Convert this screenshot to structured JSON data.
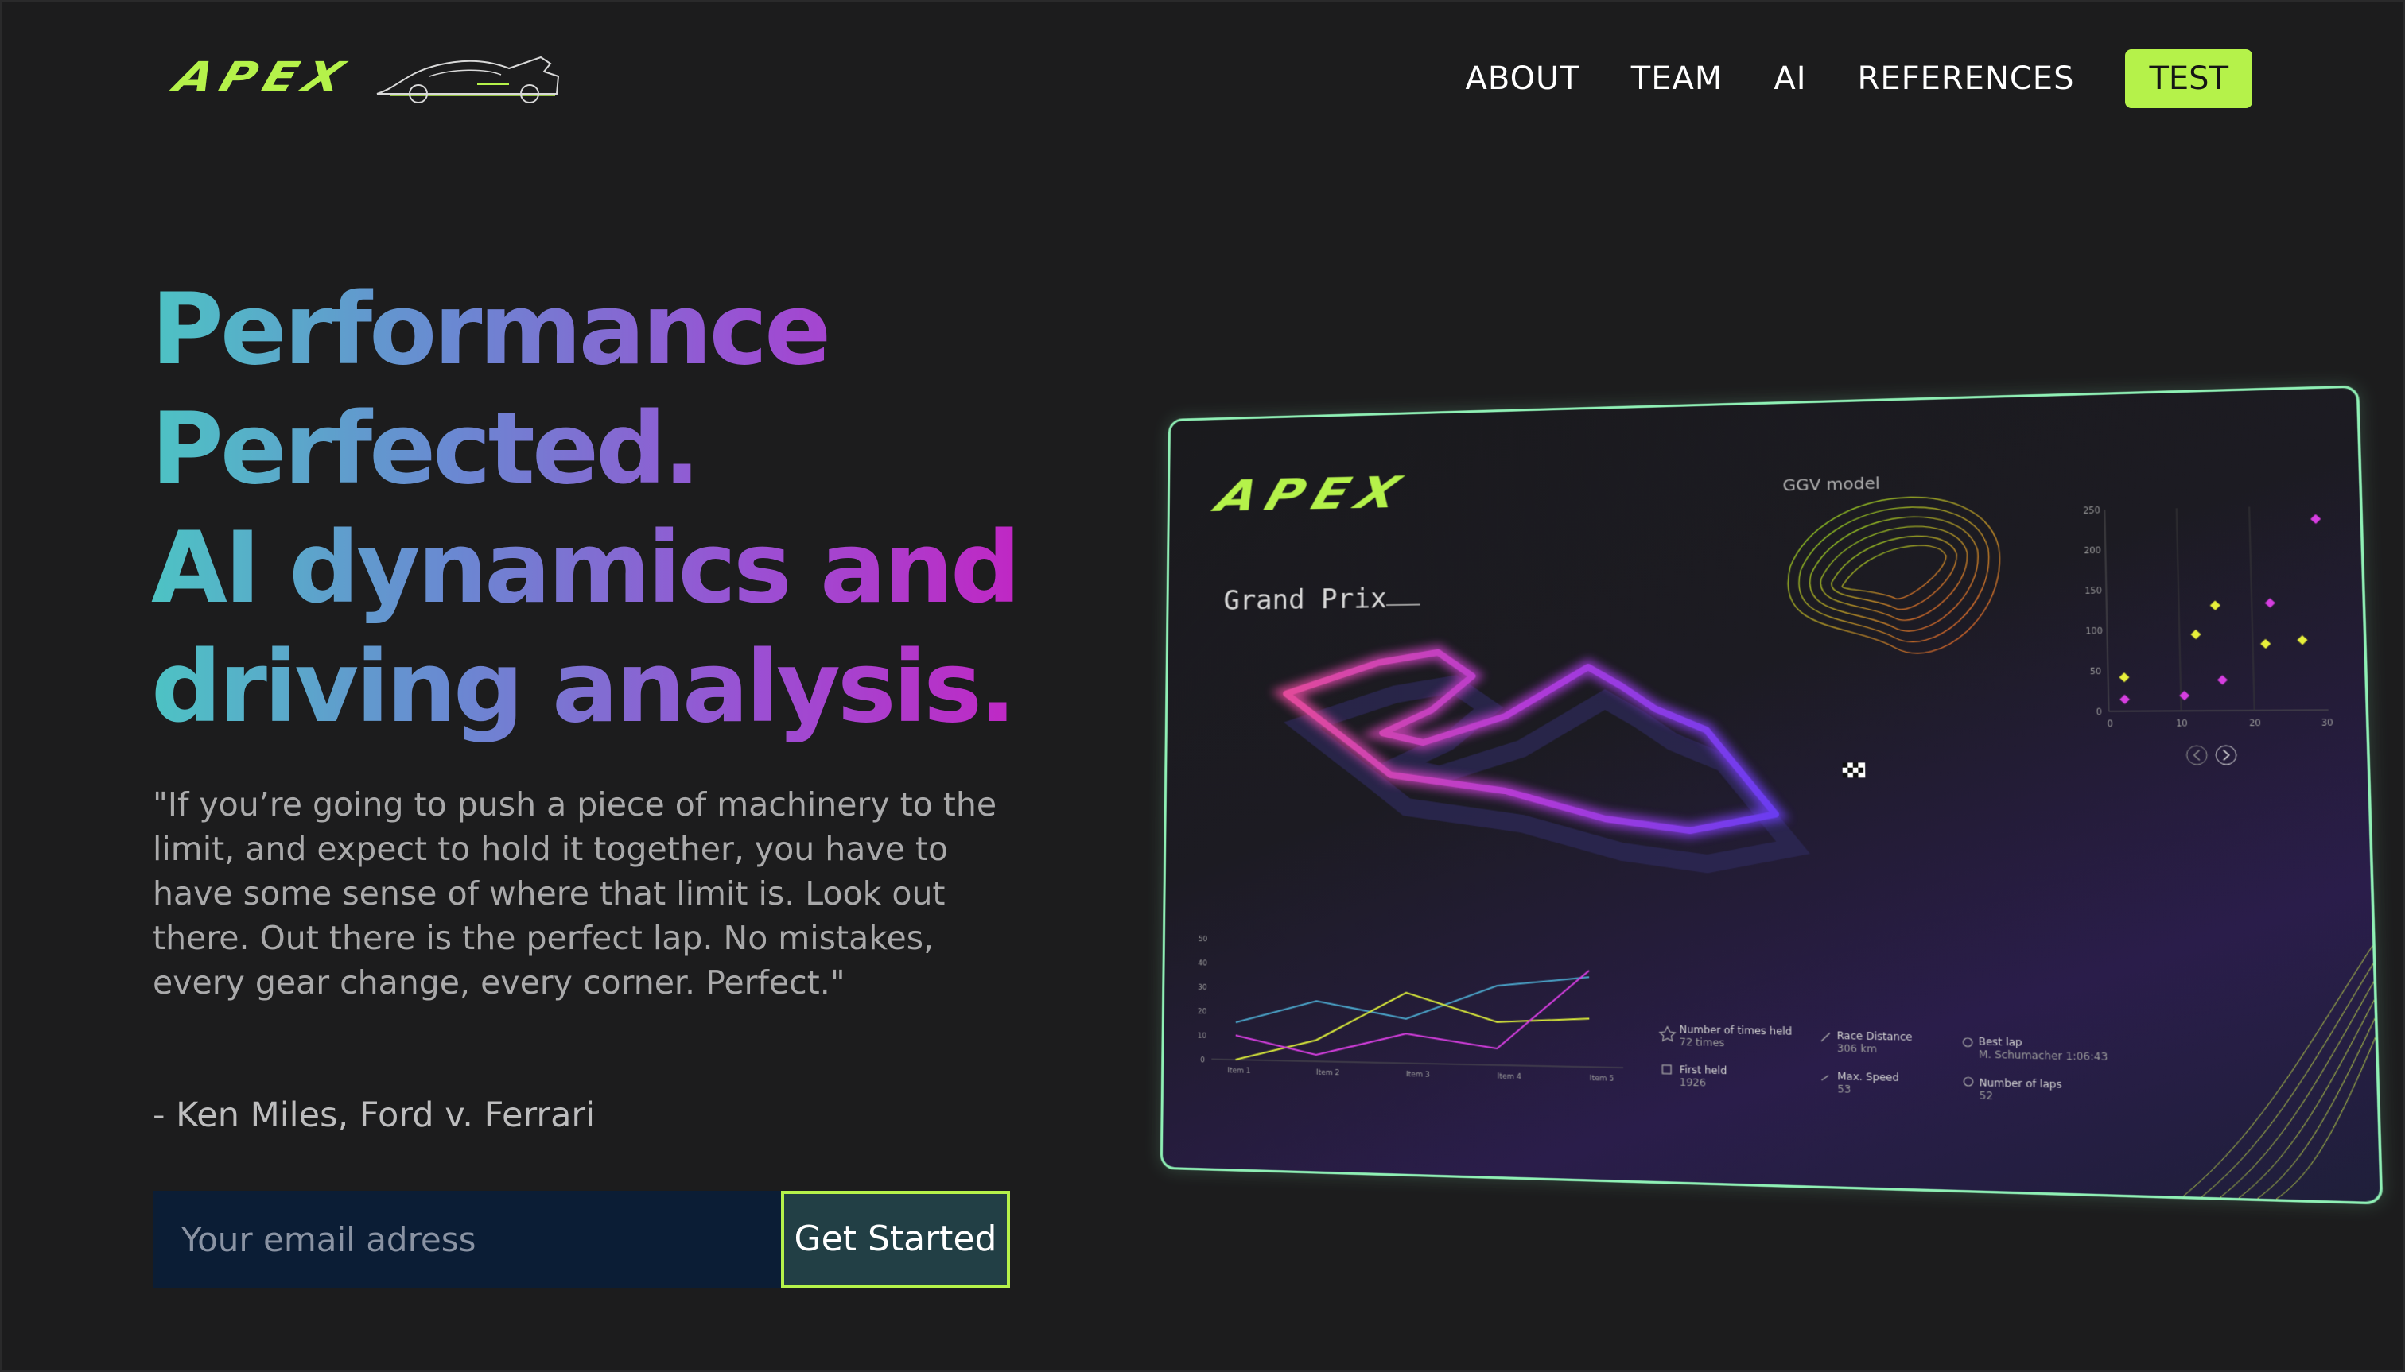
{
  "nav": {
    "logo": "APEX",
    "links": [
      "ABOUT",
      "TEAM",
      "AI",
      "REFERENCES"
    ],
    "cta": "TEST"
  },
  "hero": {
    "title_lines": [
      "Performance",
      "Perfected.",
      "AI dynamics and",
      "driving analysis."
    ],
    "quote": "\"If you’re going to push a piece of machinery to the limit, and expect to hold it together, you have to have some sense of where that limit is. Look out there. Out there is the perfect lap. No mistakes, every gear change, every corner. Perfect.\"",
    "attribution": "- Ken Miles, Ford v. Ferrari",
    "email_placeholder": "Your email adress",
    "cta": "Get Started"
  },
  "dashboard": {
    "logo": "APEX",
    "title": "Grand Prix",
    "ggv_label": "GGV model",
    "stats": [
      {
        "label": "Number of times held",
        "value": "72 times"
      },
      {
        "label": "First held",
        "value": "1926"
      },
      {
        "label": "Race Distance",
        "value": "306 km"
      },
      {
        "label": "Max. Speed",
        "value": "53"
      },
      {
        "label": "Best lap",
        "value": "M. Schumacher 1:06:43"
      },
      {
        "label": "Number of laps",
        "value": "52"
      }
    ],
    "line_y_ticks": [
      "50",
      "40",
      "30",
      "20",
      "10",
      "0"
    ],
    "line_x_ticks": [
      "Item 1",
      "Item 2",
      "Item 3",
      "Item 4",
      "Item 5"
    ],
    "scatter_y_ticks": [
      "250",
      "200",
      "150",
      "100",
      "50",
      "0"
    ],
    "scatter_x_ticks": [
      "0",
      "10",
      "20",
      "30"
    ]
  },
  "colors": {
    "accent": "#b5f24a",
    "background": "#1c1c1d",
    "gradient": [
      "#4dc3c4",
      "#6a88d2",
      "#9b4fd3",
      "#c027c4"
    ]
  }
}
